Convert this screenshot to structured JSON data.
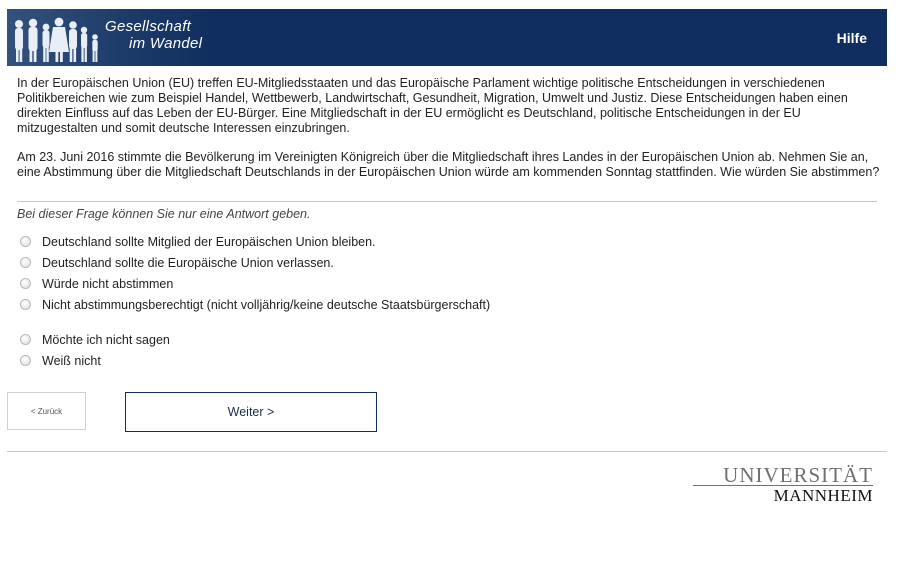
{
  "header": {
    "logo_line1": "Gesellschaft",
    "logo_line2": "im Wandel",
    "help_label": "Hilfe",
    "color": "#0f2e5f"
  },
  "intro": {
    "paragraph1": "In der Europäischen Union (EU) treffen EU-Mitgliedsstaaten und das Europäische Parlament wichtige politische Entscheidungen in verschiedenen Politikbereichen wie zum Beispiel Handel, Wettbewerb, Landwirtschaft, Gesundheit, Migration, Umwelt und Justiz. Diese Entscheidungen haben einen direkten Einfluss auf das Leben der EU-Bürger. Eine Mitgliedschaft in der EU ermöglicht es Deutschland, politische Entscheidungen in der EU mitzugestalten und somit deutsche Interessen einzubringen.",
    "paragraph2": "Am 23. Juni 2016 stimmte die Bevölkerung im Vereinigten Königreich über die Mitgliedschaft ihres Landes in der Europäischen Union ab. Nehmen Sie an, eine Abstimmung über die Mitgliedschaft Deutschlands in der Europäischen Union würde am kommenden Sonntag stattfinden. Wie würden Sie abstimmen?"
  },
  "question": {
    "instruction": "Bei dieser Frage können Sie nur eine Antwort geben.",
    "options": [
      "Deutschland sollte Mitglied der Europäischen Union bleiben.",
      "Deutschland sollte die Europäische Union verlassen.",
      "Würde nicht abstimmen",
      "Nicht abstimmungsberechtigt (nicht volljährig/keine deutsche Staatsbürgerschaft)",
      "Möchte ich nicht sagen",
      "Weiß nicht"
    ]
  },
  "nav": {
    "back_label": "< Zurück",
    "next_label": "Weiter >"
  },
  "footer": {
    "uni_top": "UNIVERSITÄT",
    "uni_bottom": "MANNHEIM"
  }
}
